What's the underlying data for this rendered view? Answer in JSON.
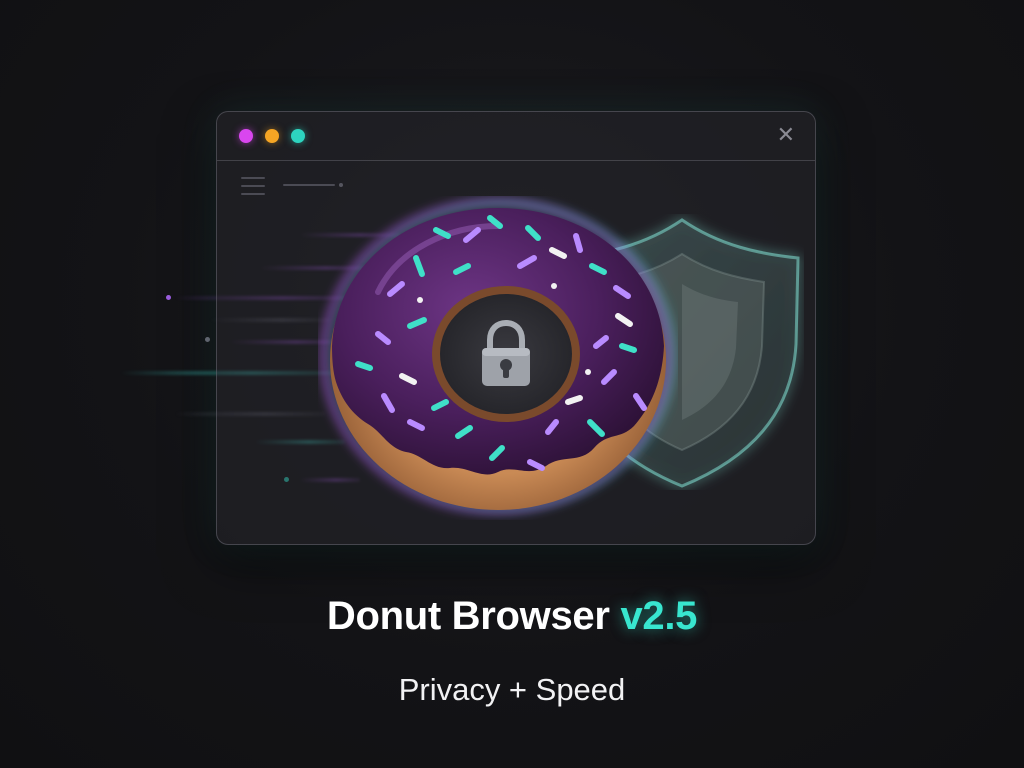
{
  "window": {
    "traffic_lights": [
      {
        "name": "magenta",
        "color": "#d946ef"
      },
      {
        "name": "amber",
        "color": "#f5a524"
      },
      {
        "name": "teal",
        "color": "#2dd4bf"
      }
    ],
    "close_icon": "close-icon",
    "menu_icon": "hamburger-menu-icon"
  },
  "illustration": {
    "main": "donut-icon",
    "secondary": "shield-icon",
    "center": "padlock-icon"
  },
  "title": {
    "name": "Donut Browser",
    "version": "v2.5"
  },
  "subtitle": "Privacy + Speed",
  "colors": {
    "background": "#121214",
    "accent_teal": "#38e6cf",
    "accent_purple": "#a855f7",
    "icing": "#4a1f5c"
  }
}
